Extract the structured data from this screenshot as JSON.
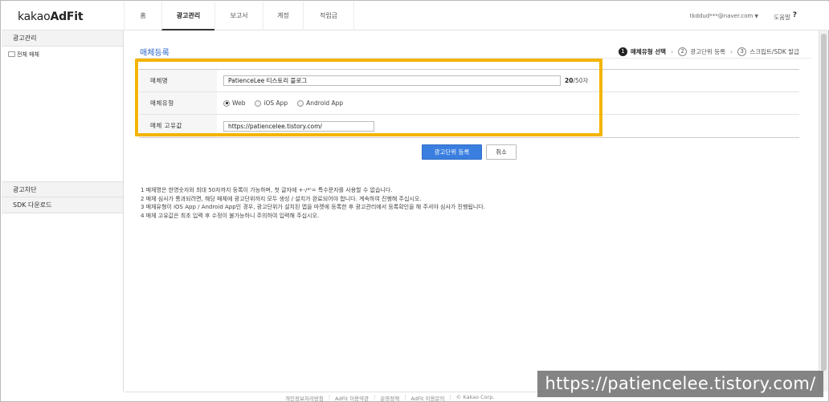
{
  "header": {
    "logo_light": "kakao",
    "logo_bold": "AdFit",
    "nav": [
      {
        "label": "홈",
        "active": false
      },
      {
        "label": "광고관리",
        "active": true
      },
      {
        "label": "보고서",
        "active": false
      },
      {
        "label": "계정",
        "active": false
      },
      {
        "label": "적립금",
        "active": false
      }
    ],
    "user_email": "tkddud***@naver.com",
    "help_label": "도움말"
  },
  "sidebar": {
    "section_ad_management": "광고관리",
    "all_media": "전체 매체",
    "section_ad_block": "광고차단",
    "section_sdk_download": "SDK 다운로드"
  },
  "main": {
    "page_title": "매체등록",
    "steps": [
      {
        "num": "1",
        "label": "매체유형 선택",
        "current": true
      },
      {
        "num": "2",
        "label": "광고단위 등록",
        "current": false
      },
      {
        "num": "3",
        "label": "스크립트/SDK 발급",
        "current": false
      }
    ],
    "form": {
      "media_name_label": "매체명",
      "media_name_value": "PatienceLee 티스토리 블로그",
      "counter_current": "20",
      "counter_max": "/50자",
      "media_type_label": "매체유형",
      "media_type_options": [
        {
          "label": "Web",
          "checked": true
        },
        {
          "label": "iOS App",
          "checked": false
        },
        {
          "label": "Android App",
          "checked": false
        }
      ],
      "unique_value_label": "매체 고유값",
      "unique_value": "https://patiencelee.tistory.com/"
    },
    "buttons": {
      "register_ad_unit": "광고단위 등록",
      "cancel": "취소"
    },
    "notes": [
      "1  매체명은 한영숫자와 최대 50자까지 등록이 가능하며, 첫 글자에 +-/*'= 특수문자를 사용할 수 없습니다.",
      "2  매체 심사가 통과되려면, 해당 매체에 광고단위까지 모두 생성 / 설치가 완료되어야 합니다. 계속하여 진행해 주십시오.",
      "3  매체유형이 iOS App / Android App인 경우, 광고단위가 설치된 앱을 마켓에 등록한 후 광고관리에서 등록확인을 해 주셔야 심사가 진행됩니다.",
      "4  매체 고유값은 최초 입력 후 수정이 불가능하니 주의하여 입력해 주십시오."
    ]
  },
  "footer": {
    "links": [
      "개인정보처리방침",
      "AdFit 이용약관",
      "운영정책",
      "AdFit 이용문의",
      "© Kakao Corp."
    ]
  },
  "watermark": "https://patiencelee.tistory.com/",
  "colors": {
    "accent_blue": "#3a7fe0",
    "title_blue": "#2a66c9",
    "highlight_yellow": "#f4b400"
  }
}
